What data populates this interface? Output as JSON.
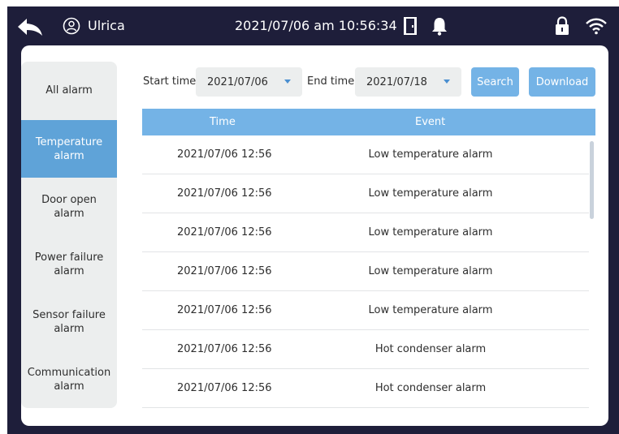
{
  "header": {
    "username": "Ulrica",
    "datetime": "2021/07/06 am 10:56:34"
  },
  "sidebar": {
    "items": [
      {
        "label": "All alarm"
      },
      {
        "label": "Temperature alarm",
        "active": true
      },
      {
        "label": "Door open alarm"
      },
      {
        "label": "Power failure alarm"
      },
      {
        "label": "Sensor failure alarm"
      },
      {
        "label": "Communication alarm"
      }
    ]
  },
  "filter": {
    "start_label": "Start time",
    "start_value": "2021/07/06",
    "end_label": "End time",
    "end_value": "2021/07/18",
    "search_label": "Search",
    "download_label": "Download"
  },
  "table": {
    "columns": [
      "Time",
      "Event"
    ],
    "rows": [
      {
        "time": "2021/07/06  12:56",
        "event": "Low temperature alarm"
      },
      {
        "time": "2021/07/06  12:56",
        "event": "Low temperature alarm"
      },
      {
        "time": "2021/07/06  12:56",
        "event": "Low temperature alarm"
      },
      {
        "time": "2021/07/06  12:56",
        "event": "Low temperature alarm"
      },
      {
        "time": "2021/07/06  12:56",
        "event": "Low temperature alarm"
      },
      {
        "time": "2021/07/06  12:56",
        "event": "Hot condenser alarm"
      },
      {
        "time": "2021/07/06  12:56",
        "event": "Hot condenser alarm"
      }
    ]
  },
  "colors": {
    "frame": "#1e1e3a",
    "accent": "#74b3e6",
    "active": "#5fa3d8",
    "sidebar_bg": "#eceeee"
  },
  "icons": [
    "back-arrow-icon",
    "user-icon",
    "door-icon",
    "bell-icon",
    "lock-icon",
    "wifi-icon",
    "caret-down-icon"
  ]
}
